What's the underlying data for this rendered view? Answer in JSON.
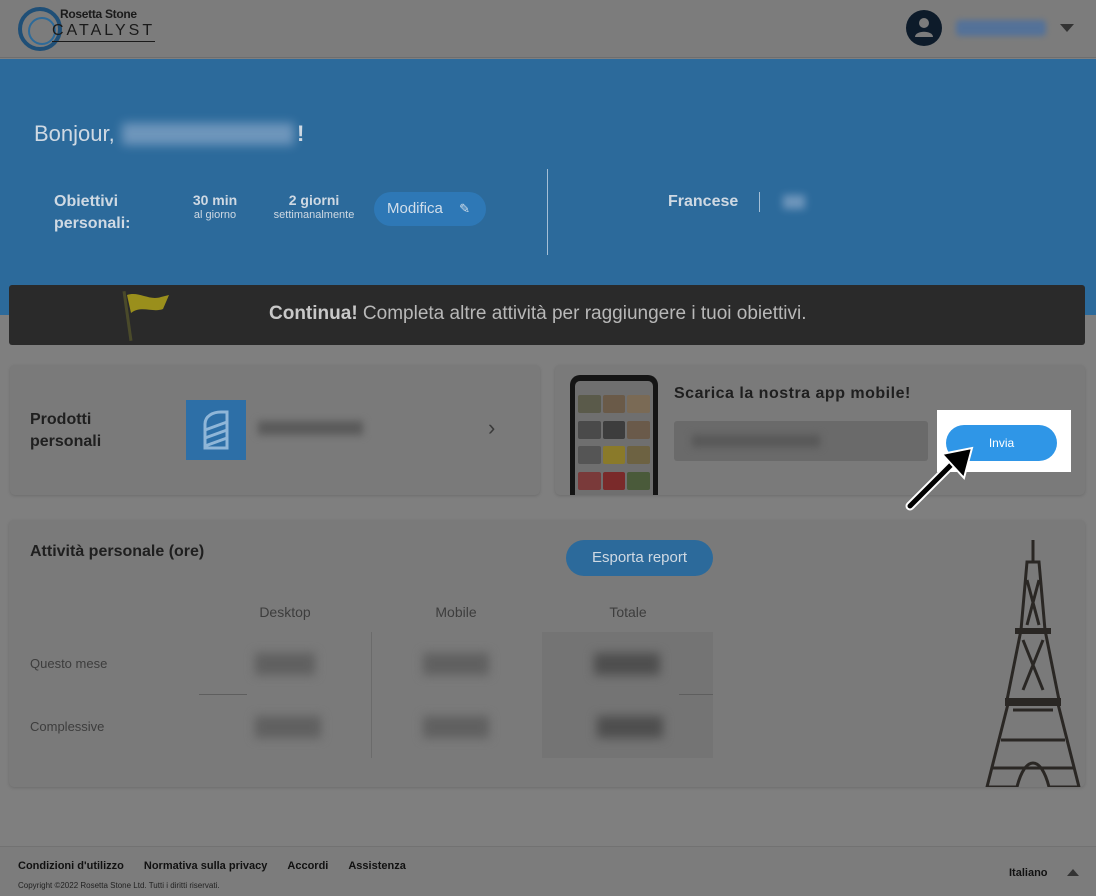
{
  "header": {
    "logo_brand": "Rosetta Stone",
    "logo_product": "CATALYST",
    "user_icon": "user-icon",
    "menu_icon": "chevron-down-icon"
  },
  "hero": {
    "greeting": "Bonjour,",
    "greeting_suffix": "!",
    "goals_label": "Obiettivi personali:",
    "goal_time_value": "30 min",
    "goal_time_unit": "al giorno",
    "goal_days_value": "2 giorni",
    "goal_days_unit": "settimanalmente",
    "modify_label": "Modifica",
    "language": "Francese"
  },
  "banner": {
    "bold": "Continua!",
    "text": " Completa altre attività per raggiungere i tuoi obiettivi."
  },
  "products": {
    "title": "Prodotti personali"
  },
  "app": {
    "title": "Scarica la nostra app mobile!",
    "send_label": "Invia"
  },
  "activity": {
    "title": "Attività personale (ore)",
    "export_label": "Esporta report",
    "columns": [
      "Desktop",
      "Mobile",
      "Totale"
    ],
    "rows": [
      "Questo mese",
      "Complessive"
    ]
  },
  "footer": {
    "links": [
      "Condizioni d'utilizzo",
      "Normativa sulla privacy",
      "Accordi",
      "Assistenza"
    ],
    "copyright": "Copyright ©2022 Rosetta Stone Ltd. Tutti i diritti riservati.",
    "language": "Italiano"
  },
  "colors": {
    "hero": "#2c6a9b",
    "accent": "#2f96e7",
    "banner": "#2a2a2a"
  }
}
